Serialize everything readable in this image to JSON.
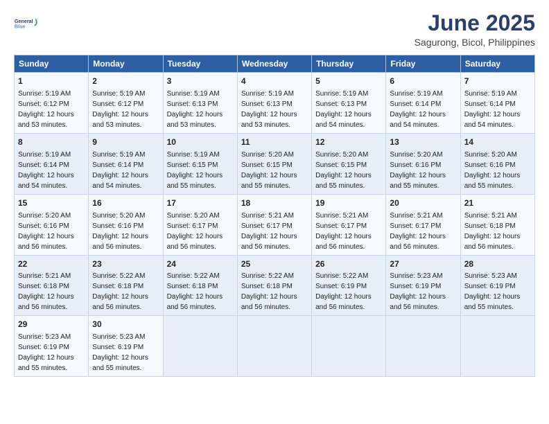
{
  "logo": {
    "line1": "General",
    "line2": "Blue"
  },
  "title": "June 2025",
  "location": "Sagurong, Bicol, Philippines",
  "days_header": [
    "Sunday",
    "Monday",
    "Tuesday",
    "Wednesday",
    "Thursday",
    "Friday",
    "Saturday"
  ],
  "weeks": [
    [
      {
        "day": "1",
        "rise": "5:19 AM",
        "set": "6:12 PM",
        "hours": "12 hours and 53 minutes."
      },
      {
        "day": "2",
        "rise": "5:19 AM",
        "set": "6:12 PM",
        "hours": "12 hours and 53 minutes."
      },
      {
        "day": "3",
        "rise": "5:19 AM",
        "set": "6:13 PM",
        "hours": "12 hours and 53 minutes."
      },
      {
        "day": "4",
        "rise": "5:19 AM",
        "set": "6:13 PM",
        "hours": "12 hours and 53 minutes."
      },
      {
        "day": "5",
        "rise": "5:19 AM",
        "set": "6:13 PM",
        "hours": "12 hours and 54 minutes."
      },
      {
        "day": "6",
        "rise": "5:19 AM",
        "set": "6:14 PM",
        "hours": "12 hours and 54 minutes."
      },
      {
        "day": "7",
        "rise": "5:19 AM",
        "set": "6:14 PM",
        "hours": "12 hours and 54 minutes."
      }
    ],
    [
      {
        "day": "8",
        "rise": "5:19 AM",
        "set": "6:14 PM",
        "hours": "12 hours and 54 minutes."
      },
      {
        "day": "9",
        "rise": "5:19 AM",
        "set": "6:14 PM",
        "hours": "12 hours and 54 minutes."
      },
      {
        "day": "10",
        "rise": "5:19 AM",
        "set": "6:15 PM",
        "hours": "12 hours and 55 minutes."
      },
      {
        "day": "11",
        "rise": "5:20 AM",
        "set": "6:15 PM",
        "hours": "12 hours and 55 minutes."
      },
      {
        "day": "12",
        "rise": "5:20 AM",
        "set": "6:15 PM",
        "hours": "12 hours and 55 minutes."
      },
      {
        "day": "13",
        "rise": "5:20 AM",
        "set": "6:16 PM",
        "hours": "12 hours and 55 minutes."
      },
      {
        "day": "14",
        "rise": "5:20 AM",
        "set": "6:16 PM",
        "hours": "12 hours and 55 minutes."
      }
    ],
    [
      {
        "day": "15",
        "rise": "5:20 AM",
        "set": "6:16 PM",
        "hours": "12 hours and 56 minutes."
      },
      {
        "day": "16",
        "rise": "5:20 AM",
        "set": "6:16 PM",
        "hours": "12 hours and 56 minutes."
      },
      {
        "day": "17",
        "rise": "5:20 AM",
        "set": "6:17 PM",
        "hours": "12 hours and 56 minutes."
      },
      {
        "day": "18",
        "rise": "5:21 AM",
        "set": "6:17 PM",
        "hours": "12 hours and 56 minutes."
      },
      {
        "day": "19",
        "rise": "5:21 AM",
        "set": "6:17 PM",
        "hours": "12 hours and 56 minutes."
      },
      {
        "day": "20",
        "rise": "5:21 AM",
        "set": "6:17 PM",
        "hours": "12 hours and 56 minutes."
      },
      {
        "day": "21",
        "rise": "5:21 AM",
        "set": "6:18 PM",
        "hours": "12 hours and 56 minutes."
      }
    ],
    [
      {
        "day": "22",
        "rise": "5:21 AM",
        "set": "6:18 PM",
        "hours": "12 hours and 56 minutes."
      },
      {
        "day": "23",
        "rise": "5:22 AM",
        "set": "6:18 PM",
        "hours": "12 hours and 56 minutes."
      },
      {
        "day": "24",
        "rise": "5:22 AM",
        "set": "6:18 PM",
        "hours": "12 hours and 56 minutes."
      },
      {
        "day": "25",
        "rise": "5:22 AM",
        "set": "6:18 PM",
        "hours": "12 hours and 56 minutes."
      },
      {
        "day": "26",
        "rise": "5:22 AM",
        "set": "6:19 PM",
        "hours": "12 hours and 56 minutes."
      },
      {
        "day": "27",
        "rise": "5:23 AM",
        "set": "6:19 PM",
        "hours": "12 hours and 56 minutes."
      },
      {
        "day": "28",
        "rise": "5:23 AM",
        "set": "6:19 PM",
        "hours": "12 hours and 55 minutes."
      }
    ],
    [
      {
        "day": "29",
        "rise": "5:23 AM",
        "set": "6:19 PM",
        "hours": "12 hours and 55 minutes."
      },
      {
        "day": "30",
        "rise": "5:23 AM",
        "set": "6:19 PM",
        "hours": "12 hours and 55 minutes."
      },
      null,
      null,
      null,
      null,
      null
    ]
  ],
  "labels": {
    "sunrise": "Sunrise:",
    "sunset": "Sunset:",
    "daylight": "Daylight:"
  }
}
